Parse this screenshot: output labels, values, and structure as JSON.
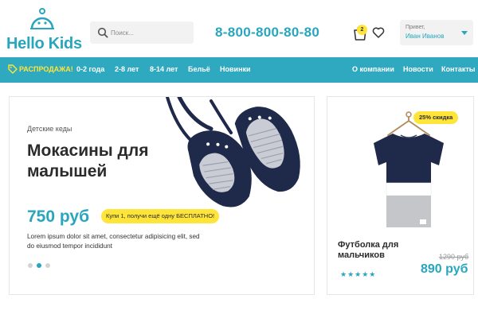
{
  "header": {
    "logo_text": "Hello Kids",
    "search_placeholder": "Поиск...",
    "phone": "8-800-800-80-80",
    "cart_count": "2",
    "account": {
      "greeting": "Привет,",
      "name": "Иван Иванов"
    }
  },
  "nav": {
    "sale": "РАСПРОДАЖА!",
    "left_items": [
      "0-2 года",
      "2-8 лет",
      "8-14 лет",
      "Бельё",
      "Новинки"
    ],
    "right_items": [
      "О компании",
      "Новости",
      "Контакты"
    ]
  },
  "banner": {
    "eyebrow": "Детские кеды",
    "title": "Мокасины для малышей",
    "price": "750 руб",
    "promo": "Купи 1, получи ещё одну БЕСПЛАТНО!",
    "description": "Lorem ipsum dolor sit amet, consectetur adipisicing elit, sed do eiusmod tempor incididunt",
    "slides": 3,
    "active_slide": 2
  },
  "card": {
    "discount": "25% скидка",
    "title": "Футболка для мальчиков",
    "old_price": "1290 руб",
    "price": "890 руб",
    "rating": "★★★★★"
  },
  "colors": {
    "accent": "#2fa9bf",
    "highlight": "#ffe43a",
    "navy": "#1f2a4a"
  },
  "icons": [
    "search-icon",
    "cart-icon",
    "heart-icon",
    "chevron-down-icon",
    "tag-icon"
  ]
}
